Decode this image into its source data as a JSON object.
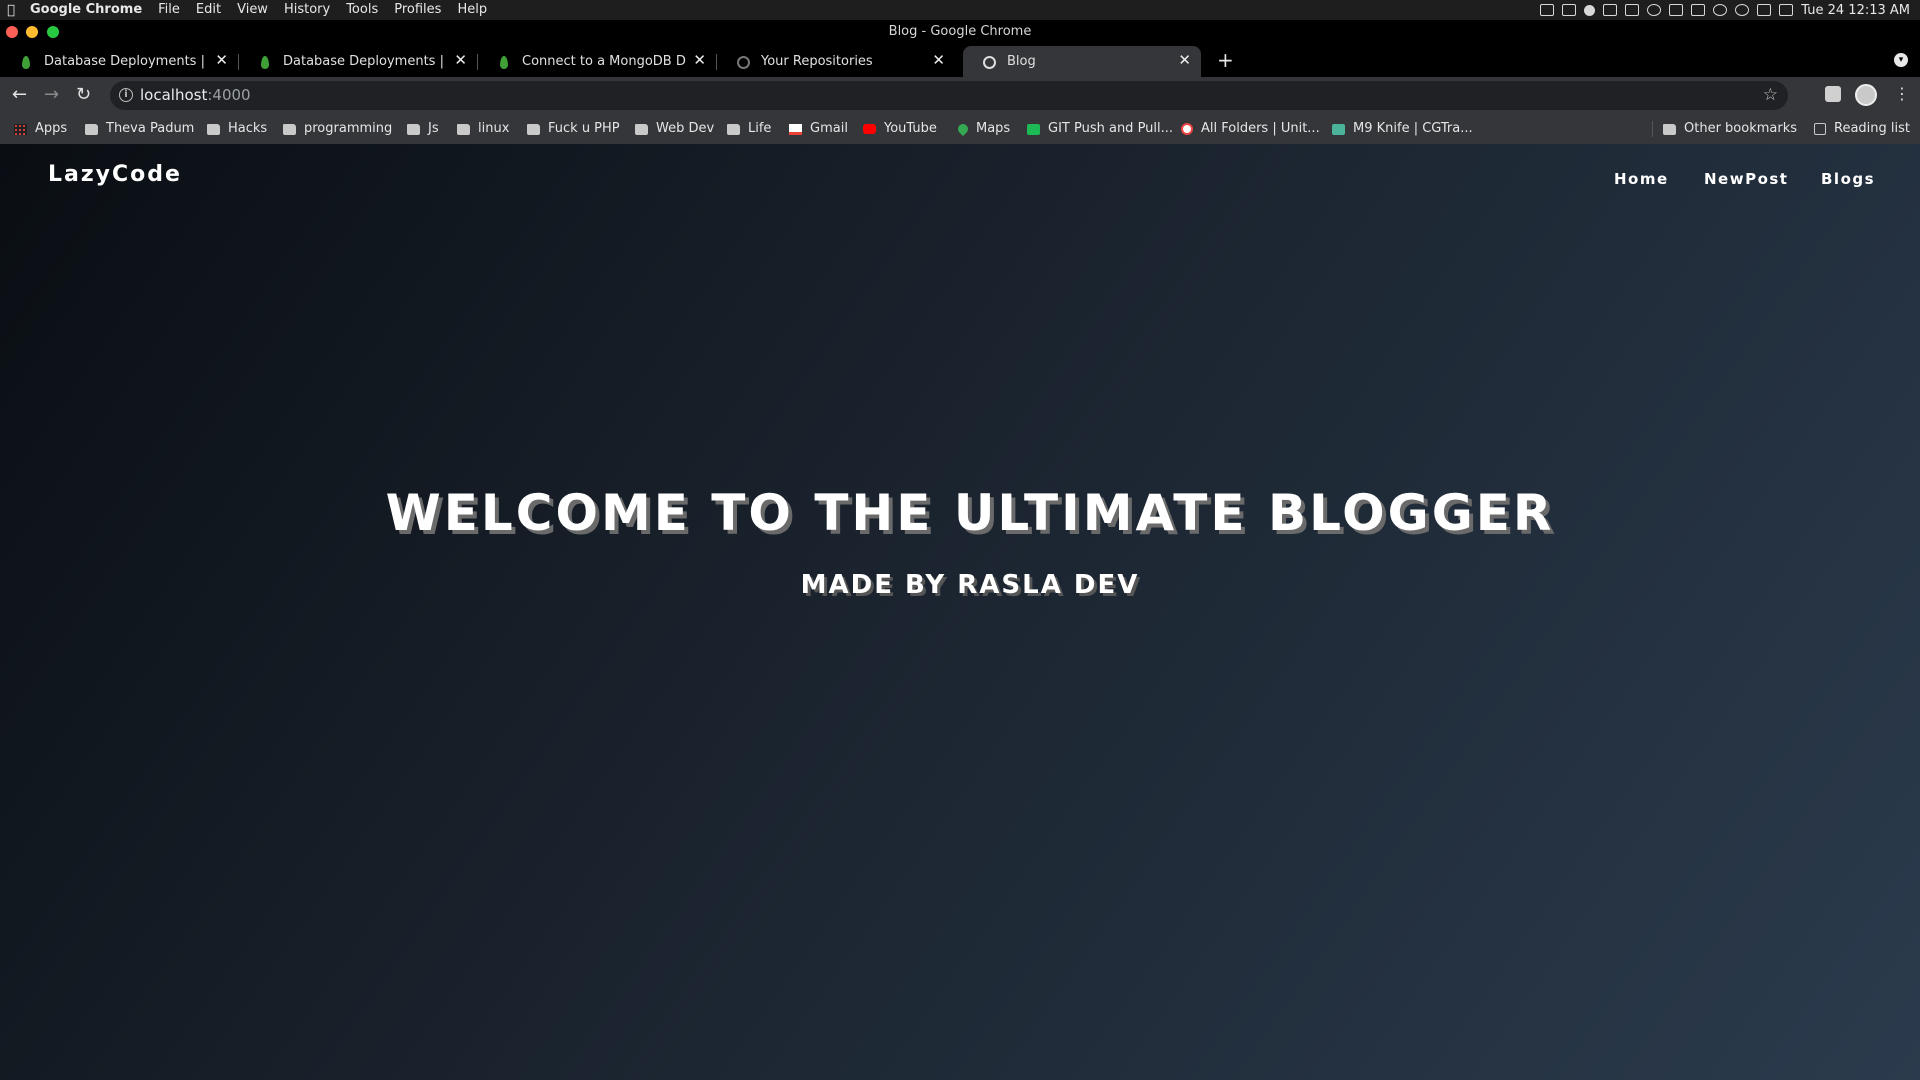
{
  "menubar": {
    "app_name": "Google Chrome",
    "menus": [
      "File",
      "Edit",
      "View",
      "History",
      "Tools",
      "Profiles",
      "Help"
    ],
    "clock": "Tue 24  12:13 AM"
  },
  "window": {
    "title": "Blog - Google Chrome"
  },
  "tabs": [
    {
      "label": "Database Deployments | Atla",
      "icon": "mongodb-leaf-icon",
      "active": false
    },
    {
      "label": "Database Deployments | Atla",
      "icon": "mongodb-leaf-icon",
      "active": false
    },
    {
      "label": "Connect to a MongoDB Datal",
      "icon": "mongodb-leaf-icon",
      "active": false
    },
    {
      "label": "Your Repositories",
      "icon": "github-icon",
      "active": false
    },
    {
      "label": "Blog",
      "icon": "globe-icon",
      "active": true
    }
  ],
  "address_bar": {
    "host": "localhost",
    "port": ":4000"
  },
  "bookmarks": [
    {
      "label": "Apps",
      "icon": "apps-grid-icon"
    },
    {
      "label": "Theva Padum",
      "icon": "folder-icon"
    },
    {
      "label": "Hacks",
      "icon": "folder-icon"
    },
    {
      "label": "programming",
      "icon": "folder-icon"
    },
    {
      "label": "Js",
      "icon": "folder-icon"
    },
    {
      "label": "linux",
      "icon": "folder-icon"
    },
    {
      "label": "Fuck u PHP",
      "icon": "folder-icon"
    },
    {
      "label": "Web Dev",
      "icon": "folder-icon"
    },
    {
      "label": "Life",
      "icon": "folder-icon"
    },
    {
      "label": "Gmail",
      "icon": "gmail-icon"
    },
    {
      "label": "YouTube",
      "icon": "youtube-icon"
    },
    {
      "label": "Maps",
      "icon": "maps-icon"
    },
    {
      "label": "GIT Push and Pull...",
      "icon": "git-icon"
    },
    {
      "label": "All Folders | Unit...",
      "icon": "folders-icon"
    },
    {
      "label": "M9 Knife | CGTra...",
      "icon": "cgtrader-icon"
    }
  ],
  "other_bookmarks": "Other bookmarks",
  "reading_list": "Reading list",
  "site": {
    "brand": "LazyCode",
    "nav": [
      "Home",
      "NewPost",
      "Blogs"
    ],
    "hero_title": "WELCOME TO THE ULTIMATE BLOGGER",
    "hero_subtitle": "MADE BY RASLA DEV"
  }
}
